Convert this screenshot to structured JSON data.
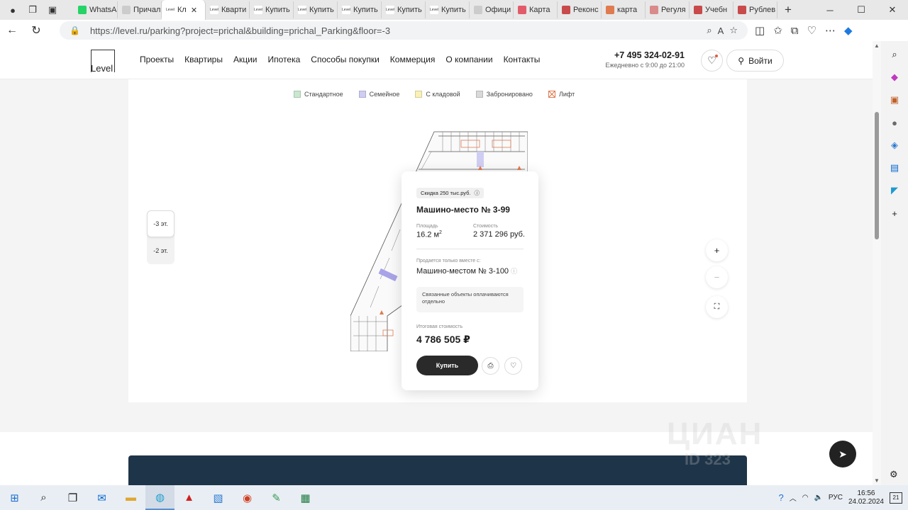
{
  "browser": {
    "tabs": [
      {
        "label": "WhatsApp",
        "fav": "",
        "color": "#25d366"
      },
      {
        "label": "Причал",
        "fav": "",
        "color": "#cccccc"
      },
      {
        "label": "Кл",
        "fav": "Level",
        "color": "#ffffff",
        "active": true
      },
      {
        "label": "Кварти",
        "fav": "Level",
        "color": "#ffffff"
      },
      {
        "label": "Купить",
        "fav": "Level",
        "color": "#ffffff"
      },
      {
        "label": "Купить",
        "fav": "Level",
        "color": "#ffffff"
      },
      {
        "label": "Купить",
        "fav": "Level",
        "color": "#ffffff"
      },
      {
        "label": "Купить",
        "fav": "Level",
        "color": "#ffffff"
      },
      {
        "label": "Купить",
        "fav": "Level",
        "color": "#ffffff"
      },
      {
        "label": "Офици",
        "fav": "",
        "color": "#cccccc"
      },
      {
        "label": "Карта",
        "fav": "",
        "color": "#e25b6a"
      },
      {
        "label": "Реконс",
        "fav": "",
        "color": "#c94a4a"
      },
      {
        "label": "карта",
        "fav": "",
        "color": "#e07b50"
      },
      {
        "label": "Регуля",
        "fav": "",
        "color": "#d98a8a"
      },
      {
        "label": "Учебн",
        "fav": "",
        "color": "#c94a4a"
      },
      {
        "label": "Рублев",
        "fav": "",
        "color": "#c94a4a"
      }
    ],
    "url": "https://level.ru/parking?project=prichal&building=prichal_Parking&floor=-3"
  },
  "site": {
    "logo": "Level",
    "menu": [
      "Проекты",
      "Квартиры",
      "Акции",
      "Ипотека",
      "Способы покупки",
      "Коммерция",
      "О компании",
      "Контакты"
    ],
    "phone": "+7 495 324-02-91",
    "hours": "Ежедневно с 9:00 до 21:00",
    "login": "Войти"
  },
  "legend": [
    {
      "label": "Стандартное",
      "color": "#c9e8cf"
    },
    {
      "label": "Семейное",
      "color": "#cfcdf2"
    },
    {
      "label": "С кладовой",
      "color": "#fbf0b6"
    },
    {
      "label": "Забронировано",
      "color": "#d9d9d9"
    },
    {
      "label": "Лифт",
      "color": "#ffffff"
    }
  ],
  "floors": [
    {
      "label": "-3 эт.",
      "active": true
    },
    {
      "label": "-2 эт.",
      "active": false
    }
  ],
  "popup": {
    "badge": "Скидка 250 тыс.руб.",
    "title": "Машино-место № 3-99",
    "area_label": "Площадь",
    "area_value": "16.2 м",
    "area_unit_sup": "2",
    "price_label": "Стоимость",
    "price_value": "2 371 296 руб.",
    "bundle_label": "Продается только вместе с:",
    "bundle_value": "Машино-местом № 3-100",
    "note": "Связанные объекты оплачиваются отдельно",
    "total_label": "Итоговая стоимость",
    "total_value": "4 786 505 ₽",
    "buy": "Купить"
  },
  "watermark": {
    "brand": "ЦИАН",
    "id": "ID 323"
  },
  "taskbar": {
    "lang": "РУС",
    "time": "16:56",
    "date": "24.02.2024",
    "notifications": "21"
  }
}
